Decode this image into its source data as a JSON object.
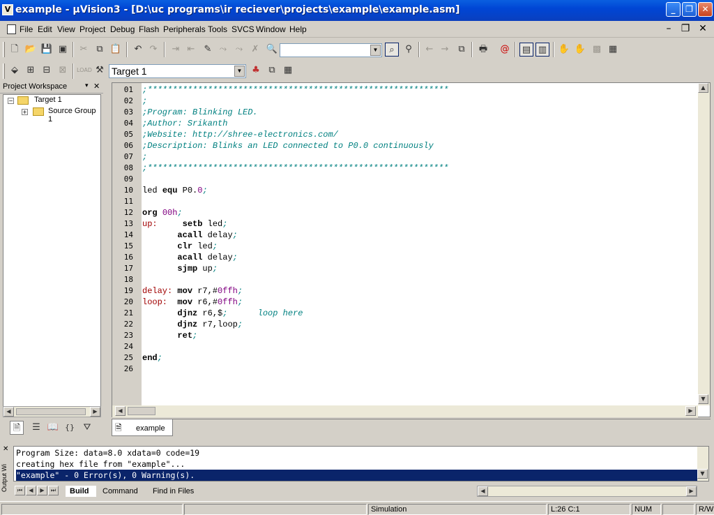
{
  "window": {
    "app_icon_letter": "V",
    "title": "example  - µVision3 - [D:\\uc programs\\ir reciever\\projects\\example\\example.asm]",
    "minimize": "_",
    "restore": "❐",
    "close": "✕"
  },
  "menu": [
    "File",
    "Edit",
    "View",
    "Project",
    "Debug",
    "Flash",
    "Peripherals",
    "Tools",
    "SVCS",
    "Window",
    "Help"
  ],
  "mdi_controls": {
    "minimize": "–",
    "restore": "❐",
    "close": "✕"
  },
  "toolbar": {
    "find_combo_value": "",
    "target_combo_value": "Target 1"
  },
  "workspace": {
    "title": "Project Workspace",
    "tree": [
      {
        "label": "Target 1",
        "expander": "−"
      },
      {
        "label": "Source Group 1",
        "expander": "+"
      }
    ]
  },
  "editor": {
    "line_numbers": [
      "01",
      "02",
      "03",
      "04",
      "05",
      "06",
      "07",
      "08",
      "09",
      "10",
      "11",
      "12",
      "13",
      "14",
      "15",
      "16",
      "17",
      "18",
      "19",
      "20",
      "21",
      "22",
      "23",
      "24",
      "25",
      "26"
    ],
    "doc_tab": "example"
  },
  "output": {
    "side_label": "Output Wi",
    "lines": [
      "Program Size: data=8.0 xdata=0 code=19",
      "creating hex file from \"example\"...",
      "\"example\" - 0 Error(s), 0 Warning(s)."
    ],
    "tabs": [
      "Build",
      "Command",
      "Find in Files"
    ],
    "active_tab": "Build"
  },
  "status": {
    "mode": "Simulation",
    "position": "L:26 C:1",
    "num": "NUM",
    "rw": "R/W"
  }
}
